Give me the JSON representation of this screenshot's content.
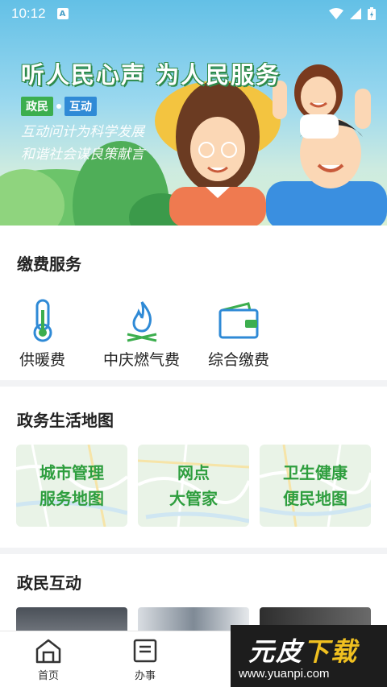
{
  "status_bar": {
    "time": "10:12",
    "notif_letter": "A"
  },
  "banner": {
    "title": "听人民心声 为人民服务",
    "tag_left": "政民",
    "tag_right": "互动",
    "subtitle_line1": "互动问计为科学发展",
    "subtitle_line2": "和谐社会谋良策献言"
  },
  "fees": {
    "title": "缴费服务",
    "items": [
      {
        "label": "供暖费",
        "icon": "thermometer-icon"
      },
      {
        "label": "中庆燃气费",
        "icon": "gas-flame-icon"
      },
      {
        "label": "综合缴费",
        "icon": "wallet-icon"
      }
    ]
  },
  "map": {
    "title": "政务生活地图",
    "cards": [
      {
        "line1": "城市管理",
        "line2": "服务地图"
      },
      {
        "line1": "网点",
        "line2": "大管家"
      },
      {
        "line1": "卫生健康",
        "line2": "便民地图"
      }
    ]
  },
  "interact": {
    "title": "政民互动"
  },
  "tabbar": {
    "tabs": [
      {
        "label": "首页",
        "icon": "home-icon"
      },
      {
        "label": "办事",
        "icon": "document-icon"
      }
    ]
  },
  "watermark": {
    "logo_a": "元皮",
    "logo_b": "下载",
    "url": "www.yuanpi.com"
  },
  "colors": {
    "accent_green": "#3cae4e",
    "accent_blue": "#2f8ad6",
    "map_text": "#2e9e3e"
  }
}
